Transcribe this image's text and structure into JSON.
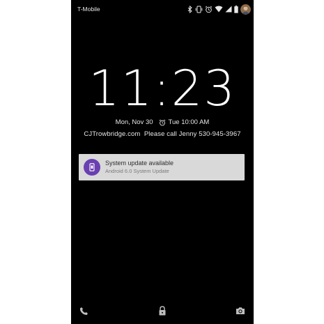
{
  "status_bar": {
    "carrier": "T-Mobile",
    "icons": [
      "bluetooth-icon",
      "vibrate-icon",
      "alarm-icon",
      "wifi-icon",
      "signal-icon",
      "battery-icon",
      "avatar"
    ]
  },
  "lockscreen": {
    "time": "11:23",
    "date": "Mon, Nov 30",
    "alarm_icon": "alarm-icon",
    "next_alarm": "Tue 10:00 AM",
    "owner_info": "CJTrowbridge.com  Please call Jenny 530-945-3967"
  },
  "notification": {
    "icon": "phone-update-icon",
    "icon_color": "#6a3fb1",
    "title": "System update available",
    "text": "Android 6.0 System Update"
  },
  "bottom_bar": {
    "left_icon": "phone-icon",
    "center_icon": "lock-icon",
    "right_icon": "camera-icon"
  }
}
